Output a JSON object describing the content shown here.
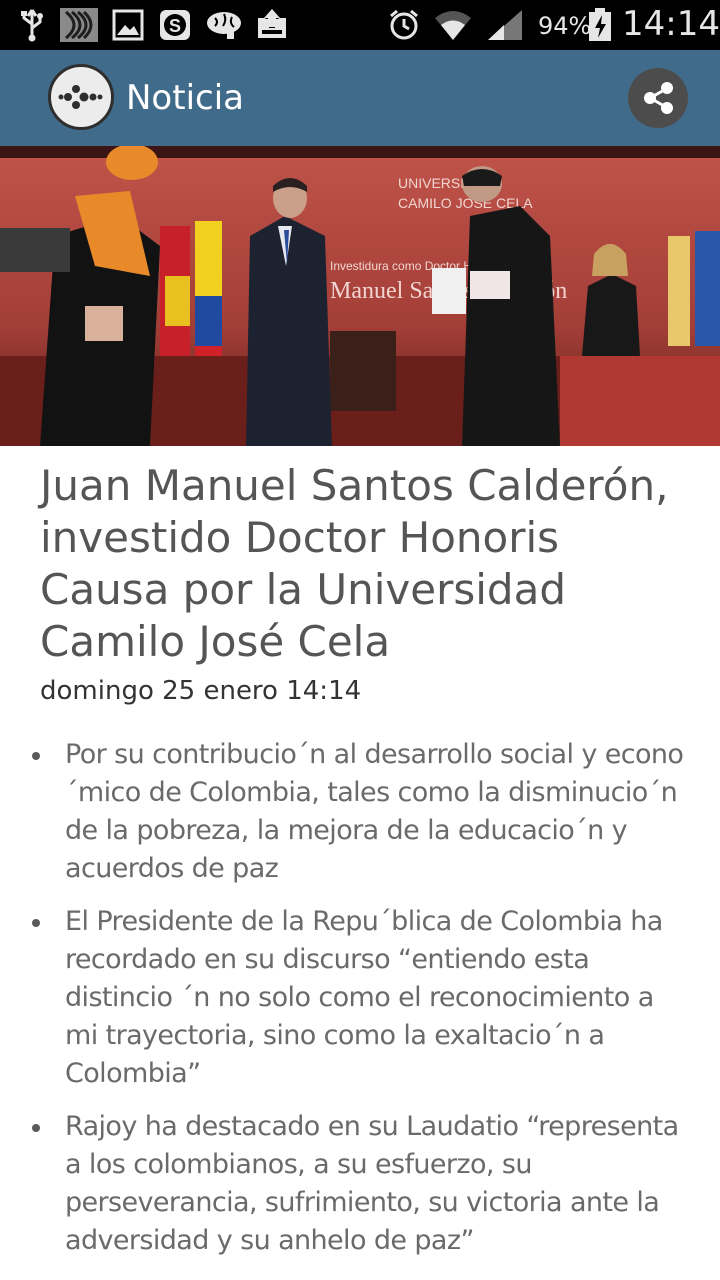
{
  "status_bar": {
    "battery": "94%",
    "time": "14:14",
    "icons": [
      "usb-icon",
      "sound-wave-icon",
      "gallery-icon",
      "skype-icon",
      "brain-icon",
      "upload-icon",
      "alarm-icon",
      "wifi-icon",
      "signal-icon",
      "battery-icon"
    ]
  },
  "app_bar": {
    "title": "Noticia",
    "logo_icon": "app-logo-icon",
    "share_icon": "share-icon",
    "color": "#416b8a"
  },
  "hero": {
    "backdrop_text": [
      "UNIVERSIDAD",
      "CAMILO JOSÉ CELA",
      "Investidura como Doctor Honoris Causa",
      "Manuel Santos Calderón"
    ]
  },
  "article": {
    "headline": "Juan Manuel Santos Calderón, investido Doctor Honoris Causa por la Universidad Camilo José Cela",
    "date": "domingo 25 enero 14:14",
    "bullets": [
      "Por su contribucio´n al desarrollo social y econo ´mico de Colombia, tales como la disminucio´n de la pobreza, la mejora de la educacio´n y acuerdos de paz",
      "El Presidente de la Repu´blica de Colombia ha recordado en su discurso “entiendo esta distincio ´n no solo como el reconocimiento a mi trayectoria, sino como la exaltacio´n a Colombia”",
      "Rajoy ha destacado en su Laudatio “representa a los colombianos, a su esfuerzo, su perseverancia, sufrimiento, su victoria ante la adversidad y su anhelo de paz”"
    ]
  }
}
